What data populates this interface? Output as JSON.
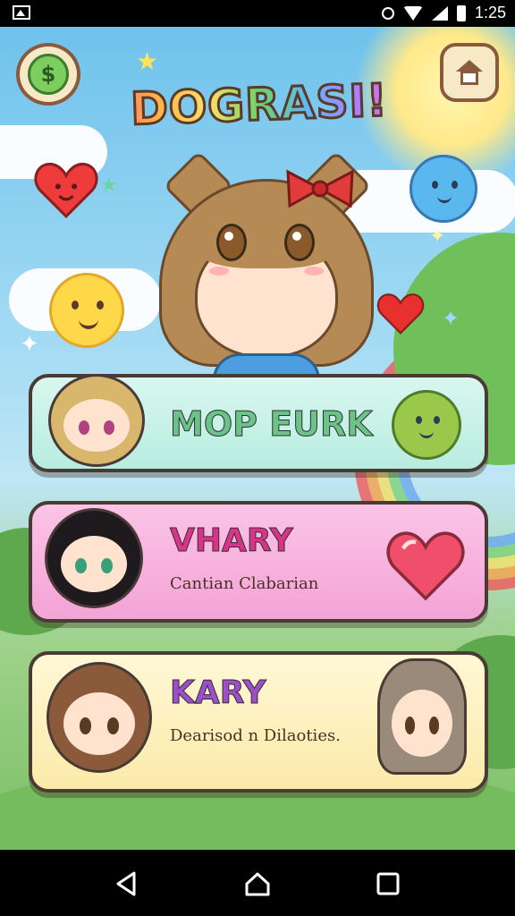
{
  "status_bar": {
    "time": "1:25"
  },
  "header": {
    "title": "DOGRASI!"
  },
  "colors": {
    "card1": "#c8f1e8",
    "card2": "#f7b6df",
    "card3": "#fdf2bf",
    "outline": "#4a3a36"
  },
  "icons": {
    "money": "money-bag-icon",
    "home": "home-icon",
    "nav_back": "back-triangle-icon",
    "nav_home": "home-circle-icon",
    "nav_recents": "recents-square-icon"
  },
  "cards": [
    {
      "title": "MOP EURK",
      "title_color": "#6cc38a",
      "subtitle": ""
    },
    {
      "title": "VHARY",
      "title_color": "#d9338a",
      "subtitle": "Cantian Clabarian"
    },
    {
      "title": "KARY",
      "title_color": "#9b4fc9",
      "subtitle": "Dearisod n Dilaoties."
    }
  ]
}
